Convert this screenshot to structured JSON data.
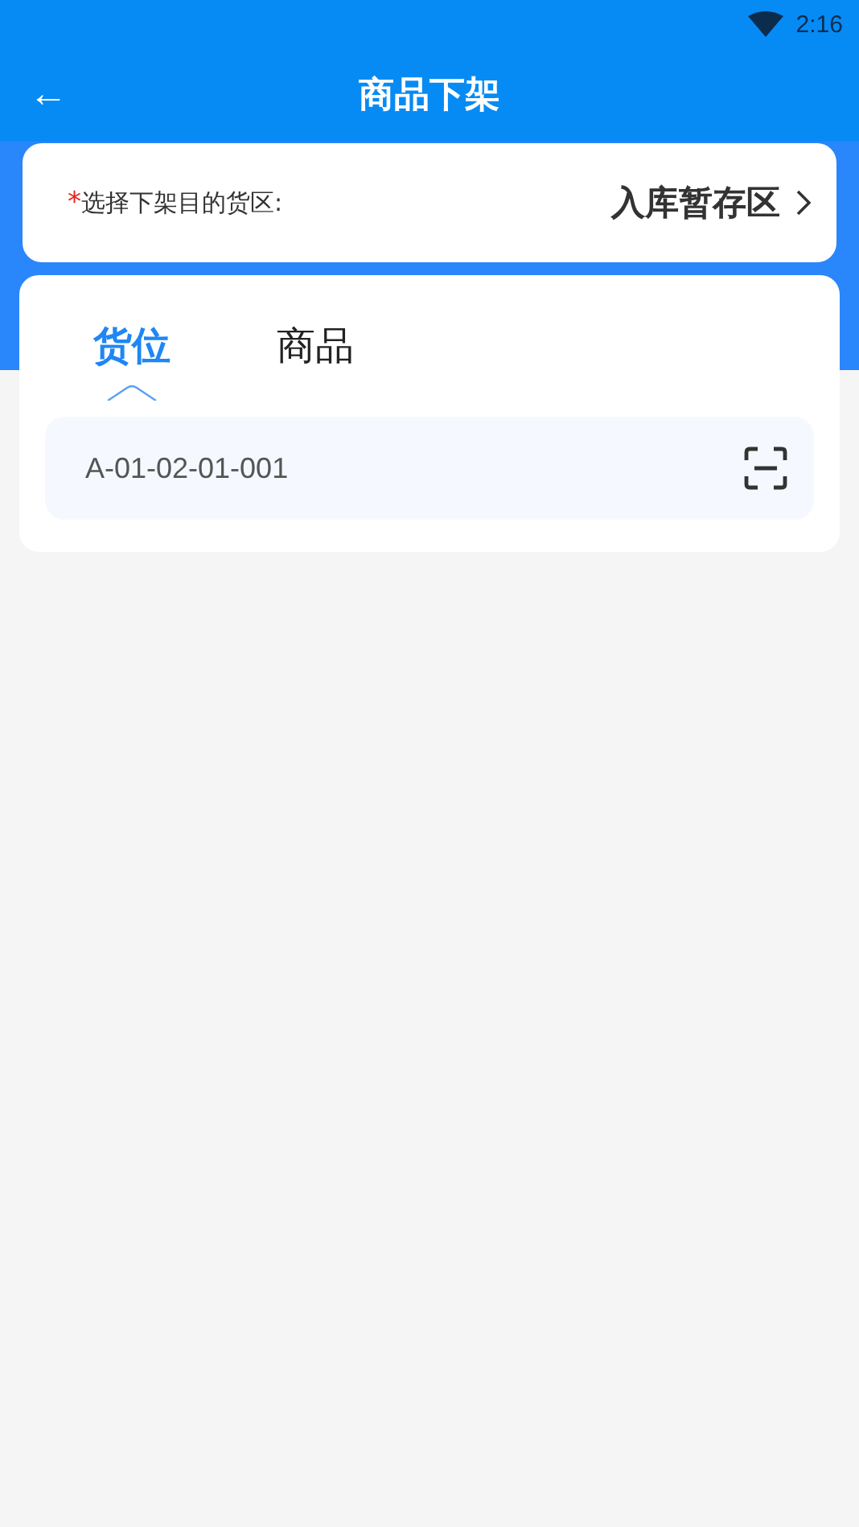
{
  "status_bar": {
    "time": "2:16"
  },
  "app_bar": {
    "title": "商品下架",
    "back": "←"
  },
  "destination": {
    "required_mark": "*",
    "label": "选择下架目的货区:",
    "value": "入库暂存区"
  },
  "tabs": [
    {
      "label": "货位",
      "selected": true
    },
    {
      "label": "商品",
      "selected": false
    }
  ],
  "search": {
    "value": "A-01-02-01-001"
  }
}
